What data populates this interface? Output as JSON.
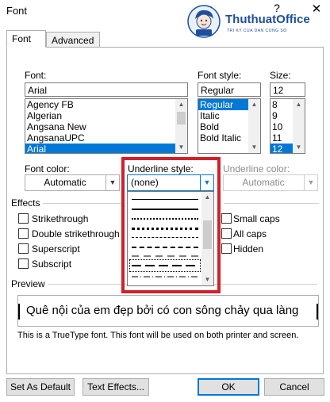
{
  "window": {
    "title": "Font",
    "help_label": "?",
    "close_label": "✕"
  },
  "watermark": {
    "name": "ThuthuatOffice",
    "tagline": "TRI KY CUA DAN CONG SO"
  },
  "tabs": [
    {
      "label": "Font",
      "active": true
    },
    {
      "label": "Advanced",
      "active": false
    }
  ],
  "font": {
    "label": "Font:",
    "value": "Arial",
    "items": [
      "Agency FB",
      "Algerian",
      "Angsana New",
      "AngsanaUPC",
      "Arial"
    ],
    "selected": "Arial"
  },
  "font_style": {
    "label": "Font style:",
    "value": "Regular",
    "items": [
      "Regular",
      "Italic",
      "Bold",
      "Bold Italic"
    ],
    "selected": "Regular"
  },
  "size": {
    "label": "Size:",
    "value": "12",
    "items": [
      "8",
      "9",
      "10",
      "11",
      "12"
    ],
    "selected": "12"
  },
  "font_color": {
    "label": "Font color:",
    "value": "Automatic"
  },
  "underline_style": {
    "label": "Underline style:",
    "value": "(none)",
    "options": [
      "solid",
      "thick-solid",
      "dotted",
      "dense-dotted",
      "dashed",
      "long-dashed",
      "dash-long",
      "long-dashed-thick",
      "dash-dot"
    ],
    "selected_option_index": 7
  },
  "underline_color": {
    "label": "Underline color:",
    "value": "Automatic"
  },
  "effects": {
    "heading": "Effects",
    "left": [
      {
        "label": "Strikethrough",
        "checked": false
      },
      {
        "label": "Double strikethrough",
        "checked": false
      },
      {
        "label": "Superscript",
        "checked": false
      },
      {
        "label": "Subscript",
        "checked": false
      }
    ],
    "right": [
      {
        "label": "Small caps",
        "checked": false
      },
      {
        "label": "All caps",
        "checked": false
      },
      {
        "label": "Hidden",
        "checked": false
      }
    ]
  },
  "preview": {
    "heading": "Preview",
    "text": "Quê nội của em đẹp bởi có con sông chảy qua làng",
    "info": "This is a TrueType font. This font will be used on both printer and screen."
  },
  "buttons": {
    "set_default": "Set As Default",
    "text_effects": "Text Effects...",
    "ok": "OK",
    "cancel": "Cancel"
  },
  "colors": {
    "highlight": "#d1212a",
    "selection": "#0078d7",
    "brand": "#1e4e9c"
  }
}
